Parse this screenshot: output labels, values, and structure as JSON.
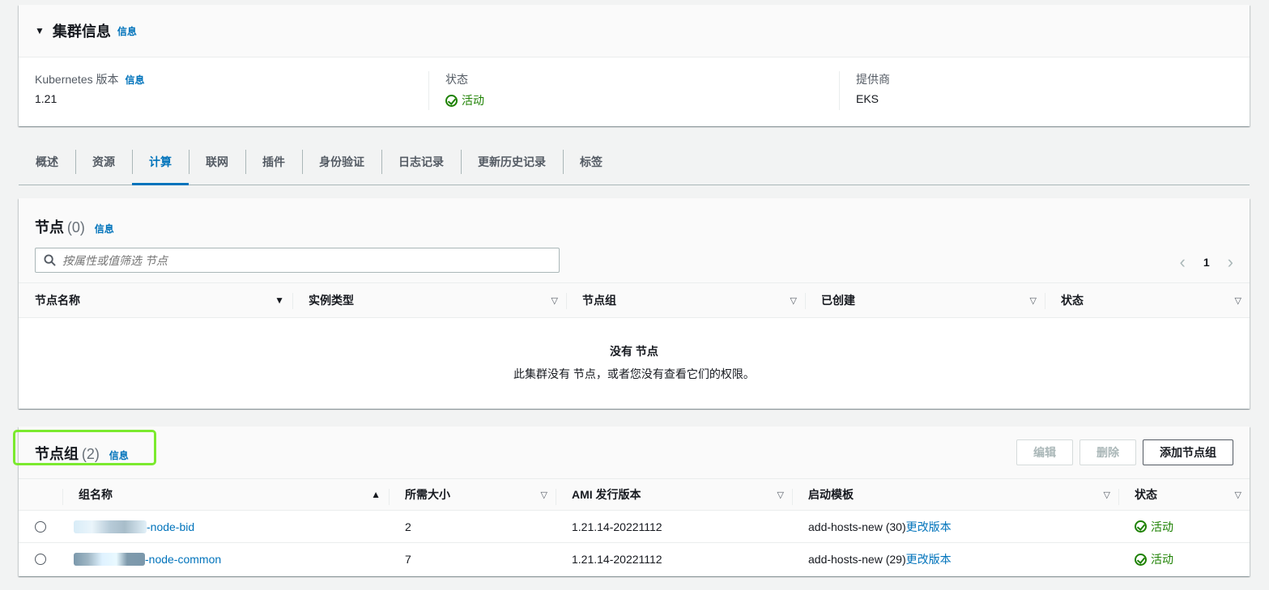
{
  "cluster_info": {
    "title": "集群信息",
    "info_link": "信息",
    "fields": [
      {
        "key": "Kubernetes 版本",
        "info": "信息",
        "value": "1.21"
      },
      {
        "key": "状态",
        "value": "活动"
      },
      {
        "key": "提供商",
        "value": "EKS"
      }
    ]
  },
  "tabs": [
    "概述",
    "资源",
    "计算",
    "联网",
    "插件",
    "身份验证",
    "日志记录",
    "更新历史记录",
    "标签"
  ],
  "active_tab": "计算",
  "nodes": {
    "title": "节点",
    "count": "(0)",
    "info_link": "信息",
    "search_placeholder": "按属性或值筛选 节点",
    "page": "1",
    "columns": [
      "节点名称",
      "实例类型",
      "节点组",
      "已创建",
      "状态"
    ],
    "empty_title": "没有 节点",
    "empty_desc": "此集群没有 节点，或者您没有查看它们的权限。"
  },
  "nodegroups": {
    "title": "节点组",
    "count": "(2)",
    "info_link": "信息",
    "buttons": {
      "edit": "编辑",
      "delete": "删除",
      "add": "添加节点组"
    },
    "columns": [
      "组名称",
      "所需大小",
      "AMI 发行版本",
      "启动模板",
      "状态"
    ],
    "rows": [
      {
        "name": "-node-bid",
        "size": "2",
        "ami": "1.21.14-20221112",
        "template": "add-hosts-new (30)",
        "template_link": "更改版本",
        "status": "活动"
      },
      {
        "name": "-node-common",
        "size": "7",
        "ami": "1.21.14-20221112",
        "template": "add-hosts-new (29)",
        "template_link": "更改版本",
        "status": "活动"
      }
    ]
  },
  "colors": {
    "link": "#0073bb",
    "success": "#1d8102",
    "highlight": "#7bea2e"
  }
}
